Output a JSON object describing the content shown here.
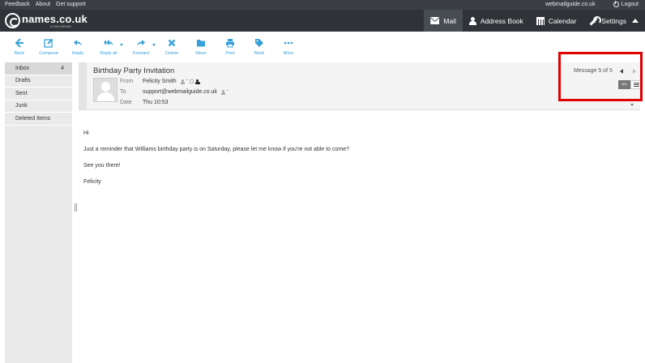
{
  "topbar": {
    "links": [
      "Feedback",
      "About",
      "Get support"
    ],
    "domain": "webmailguide.co.uk",
    "logout": "Logout"
  },
  "header": {
    "logo": "names.co.uk",
    "logo_sub": "A DADA BRAND",
    "nav": [
      {
        "label": "Mail",
        "icon": "mail-icon",
        "active": true
      },
      {
        "label": "Address Book",
        "icon": "person-icon",
        "active": false
      },
      {
        "label": "Calendar",
        "icon": "calendar-icon",
        "active": false
      },
      {
        "label": "Settings",
        "icon": "wrench-icon",
        "active": false
      }
    ]
  },
  "toolbar": {
    "buttons": [
      "Back",
      "Compose",
      "Reply",
      "Reply all",
      "Forward",
      "Delete",
      "Move",
      "Print",
      "Mark",
      "More"
    ]
  },
  "folders": [
    {
      "name": "Inbox",
      "count": "4"
    },
    {
      "name": "Drafts",
      "count": ""
    },
    {
      "name": "Sent",
      "count": ""
    },
    {
      "name": "Junk",
      "count": ""
    },
    {
      "name": "Deleted Items",
      "count": ""
    }
  ],
  "message": {
    "subject": "Birthday Party Invitation",
    "from_label": "From",
    "from": "Felicity Smith",
    "to_label": "To",
    "to": "support@webmailguide.co.uk",
    "date_label": "Date",
    "date": "Thu 10:53",
    "position": "Message 5 of 5",
    "body": [
      "Hi",
      "Just a reminder that Williams birthday party is on Saturday, please let me know if you're not able to come?",
      "See you there!",
      "Felicity"
    ]
  },
  "colors": {
    "accent": "#37a0d8",
    "header_bg": "#2f3237",
    "highlight": "#e00000"
  }
}
